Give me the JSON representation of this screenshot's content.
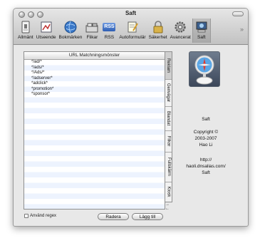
{
  "window": {
    "title": "Saft"
  },
  "toolbar": {
    "items": [
      {
        "label": "Allmänt",
        "icon": "general-icon"
      },
      {
        "label": "Utseende",
        "icon": "appearance-icon"
      },
      {
        "label": "Bokmärken",
        "icon": "bookmarks-globe-icon"
      },
      {
        "label": "Flikar",
        "icon": "tabs-icon"
      },
      {
        "label": "RSS",
        "icon": "rss-icon"
      },
      {
        "label": "Autoformulär",
        "icon": "autofill-icon"
      },
      {
        "label": "Säkerhet",
        "icon": "security-lock-icon"
      },
      {
        "label": "Avancerat",
        "icon": "advanced-gear-icon"
      },
      {
        "label": "Saft",
        "icon": "saft-icon"
      }
    ],
    "rss_text": "RSS",
    "selected": "Saft",
    "overflow": "»"
  },
  "table": {
    "header": "URL Matchningsmönster",
    "rows": [
      "*/ad/*",
      "*/ads/*",
      "*/Ads/*",
      "*/adserver*",
      "*adclick*",
      "*promotion*",
      "*sponsor*"
    ]
  },
  "side_tabs": {
    "items": [
      "Reklam",
      "Genvägar",
      "Blandat",
      "Flikar",
      "Fullskärm",
      "Kiosk"
    ],
    "selected": "Reklam",
    "arrows": [
      "→",
      "←"
    ]
  },
  "footer": {
    "checkbox_label": "Använd regex",
    "checkbox_checked": false,
    "remove_button": "Radera",
    "add_button": "Lägg till"
  },
  "about": {
    "name": "Saft",
    "copyright_line1": "Copyright ©",
    "copyright_line2": "2003-2007",
    "author": "Hao Li",
    "url_line1": "http://",
    "url_line2": "haoli.dnsalias.com/",
    "url_line3": "Saft"
  },
  "colors": {
    "table_stripe": "#edf3fe",
    "toolbar_bg": "#c8c8c8",
    "window_bg": "#e8e8e8"
  }
}
